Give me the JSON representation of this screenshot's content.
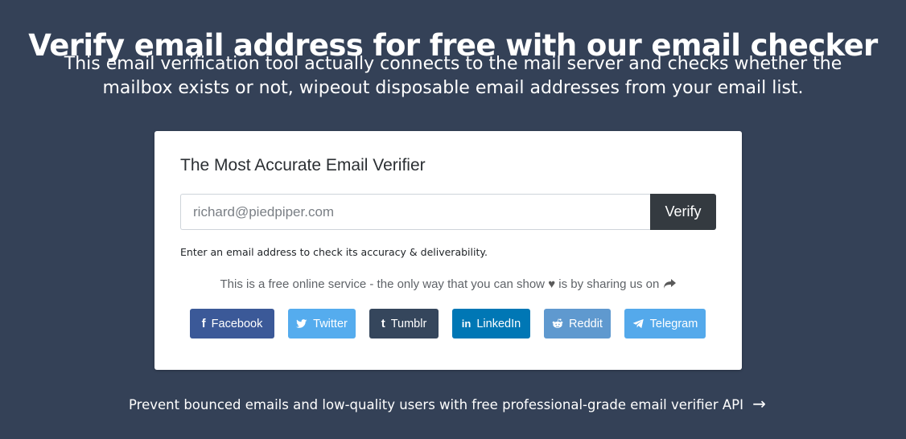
{
  "hero": {
    "title": "Verify email address for free with our email checker",
    "subtitle": "This email verification tool actually connects to the mail server and checks whether the mailbox exists or not, wipeout disposable email addresses from your email list."
  },
  "card": {
    "title": "The Most Accurate Email Verifier",
    "email_placeholder": "richard@piedpiper.com",
    "verify_label": "Verify",
    "helper_text": "Enter an email address to check its accuracy & deliverability.",
    "share_text_before": "This is a free online service - the only way that you can show",
    "share_text_after": "is by sharing us on",
    "social": [
      {
        "label": "Facebook",
        "icon": "facebook-icon",
        "color": "#3b5998"
      },
      {
        "label": "Twitter",
        "icon": "twitter-icon",
        "color": "#55acee"
      },
      {
        "label": "Tumblr",
        "icon": "tumblr-icon",
        "color": "#35465c"
      },
      {
        "label": "LinkedIn",
        "icon": "linkedin-icon",
        "color": "#0077b5"
      },
      {
        "label": "Reddit",
        "icon": "reddit-icon",
        "color": "#5f99cf"
      },
      {
        "label": "Telegram",
        "icon": "telegram-icon",
        "color": "#54a9eb"
      }
    ]
  },
  "footer": {
    "link_text": "Prevent bounced emails and low-quality users with free professional-grade email verifier API",
    "arrow": "→"
  },
  "colors": {
    "background": "#344157",
    "verify_button": "#343a40"
  }
}
